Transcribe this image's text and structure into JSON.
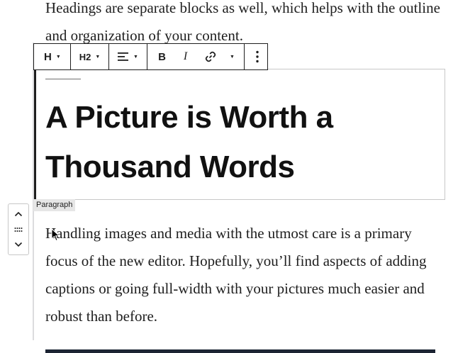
{
  "intro": {
    "text": "Headings are separate blocks as well, which helps with the outline and organization of your content."
  },
  "toolbar": {
    "block_type_label": "H",
    "heading_level_label": "H2",
    "icons": {
      "align": "align-left-icon",
      "bold": "bold-icon",
      "italic": "italic-icon",
      "link": "link-icon",
      "more_rich_text": "chevron-down-icon",
      "options": "vertical-ellipsis-icon"
    },
    "bold_label": "B",
    "italic_label": "I"
  },
  "heading_block": {
    "text": "A Picture is Worth a Thousand Words"
  },
  "block_label": "Paragraph",
  "mover": {
    "icons": [
      "chevron-up-icon",
      "drag-handle-icon",
      "chevron-down-icon"
    ]
  },
  "paragraph": {
    "text": "Handling images and media with the utmost care is a primary focus of the new editor. Hopefully, you’ll find aspects of adding captions or going full-width with your pictures much easier and robust than before."
  },
  "colors": {
    "text": "#1e1e1e",
    "border": "#1e1e1e",
    "light_border": "#c7c7c7",
    "label_bg": "#e6e6e6",
    "image_strip": "#1c2433"
  }
}
